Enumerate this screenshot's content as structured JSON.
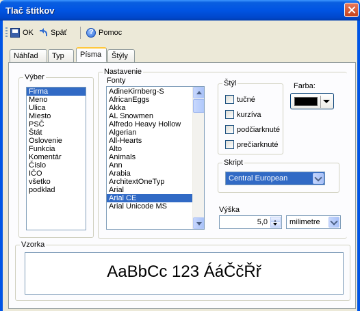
{
  "window": {
    "title": "Tlač štítkov"
  },
  "toolbar": {
    "ok_label": "OK",
    "back_label": "Späť",
    "help_label": "Pomoc"
  },
  "tabs": [
    {
      "label": "Náhľad"
    },
    {
      "label": "Typ"
    },
    {
      "label": "Písma"
    },
    {
      "label": "Štýly"
    }
  ],
  "vyber": {
    "label": "Výber",
    "items": [
      "Firma",
      "Meno",
      "Ulica",
      "Miesto",
      "PSČ",
      "Štát",
      "Oslovenie",
      "Funkcia",
      "Komentár",
      "Číslo",
      "IČO",
      "všetko",
      "podklad"
    ],
    "selected": "Firma"
  },
  "nastavenie": {
    "label": "Nastavenie",
    "fonts_label": "Fonty",
    "fonts": [
      "AdineKirnberg-S",
      "AfricanEggs",
      "Akka",
      "AL Snowmen",
      "Alfredo Heavy Hollow",
      "Algerian",
      "All-Hearts",
      "Alto",
      "Animals",
      "Ann",
      "Arabia",
      "ArchitextOneTyp",
      "Arial",
      "Arial CE",
      "Arial Unicode MS"
    ],
    "selected_font": "Arial CE"
  },
  "styl": {
    "label": "Štýl",
    "bold": "tučné",
    "italic": "kurzíva",
    "underline": "podčiarknuté",
    "strikeout": "prečiarknuté"
  },
  "farba": {
    "label": "Farba:",
    "value": "#000000"
  },
  "skript": {
    "label": "Skript",
    "value": "Central European"
  },
  "vyska": {
    "label": "Výška",
    "value": "5,0",
    "unit": "milimetre"
  },
  "vzorka": {
    "label": "Vzorka",
    "text": "AaBbCc 123 ÁáČčŘř"
  },
  "colors": {
    "selection": "#316ac5",
    "titlebar": "#0054e3",
    "active_tab": "#ffc83c"
  }
}
